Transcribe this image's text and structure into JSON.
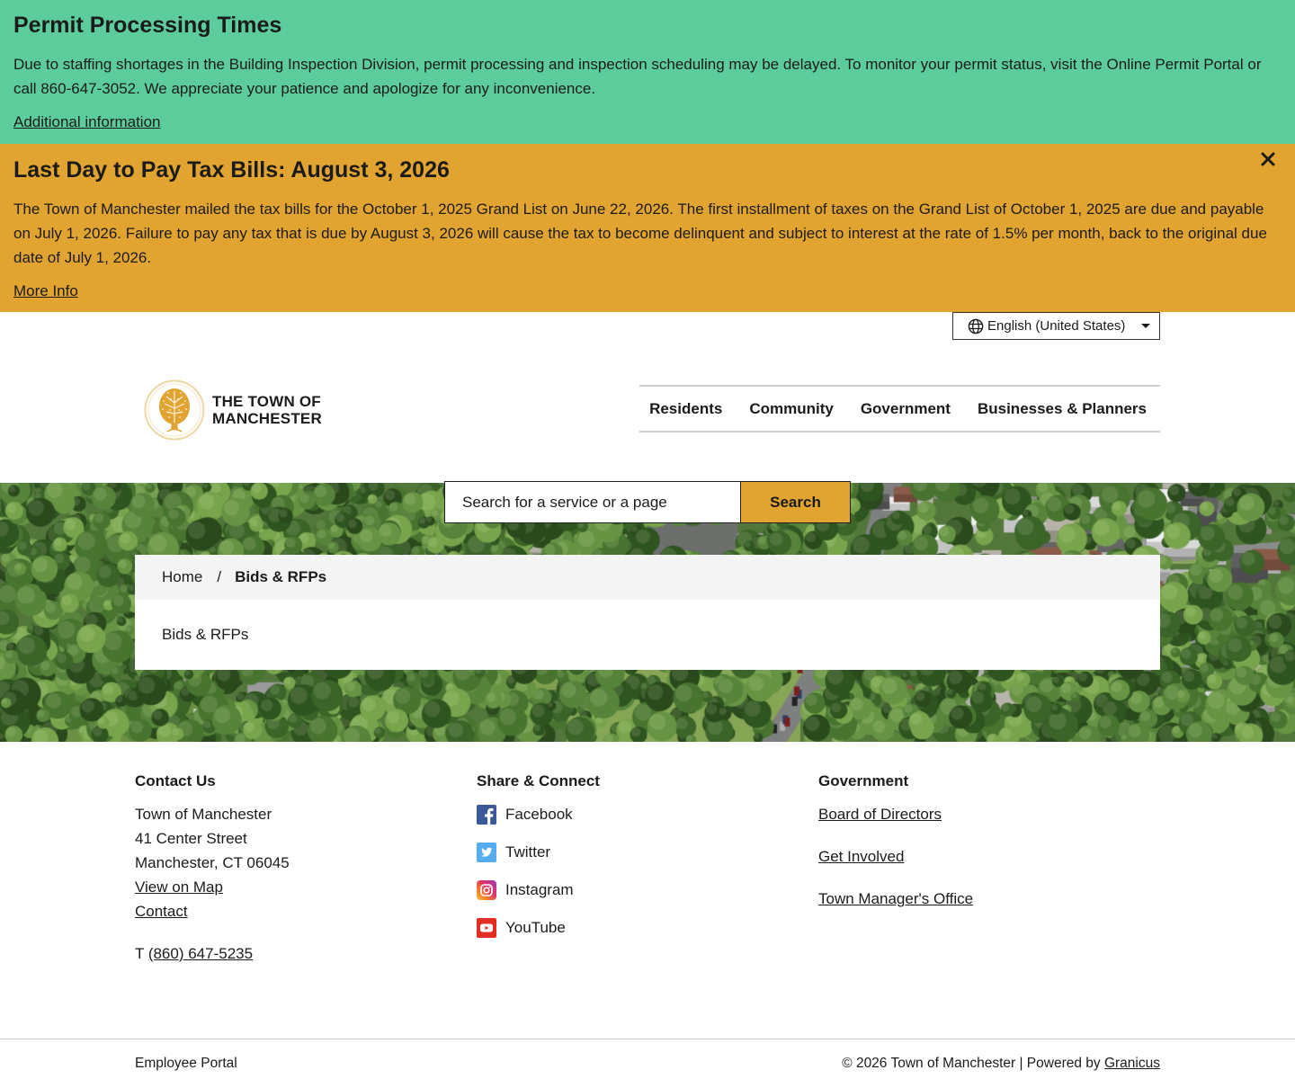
{
  "theme": {
    "alert_green": "#5CCC9C",
    "alert_orange": "#E2A431",
    "accent": "#E2A431"
  },
  "alerts": {
    "permit": {
      "title": "Permit Processing Times",
      "body": "Due to staffing shortages in the Building Inspection Division, permit processing and inspection scheduling may be delayed. To monitor your permit status, visit the Online Permit Portal or call 860-647-3052. We appreciate your patience and apologize for any inconvenience.",
      "link": "Additional information"
    },
    "tax": {
      "title": "Last Day to Pay Tax Bills: August 3, 2026",
      "body": "The Town of Manchester mailed the tax bills for the October 1, 2025 Grand List on June 22, 2026. The first installment of taxes on the Grand List of October 1, 2025 are due and payable on July 1, 2026. Failure to pay any tax that is due by August 3, 2026 will cause the tax to become delinquent and subject to interest at the rate of 1.5% per month, back to the original due date of July 1, 2026.",
      "link": "More Info",
      "close_icon": "close-icon"
    }
  },
  "language": {
    "selected": "English (United States)",
    "icon": "globe-icon"
  },
  "header": {
    "logo_icon": "town-seal-tree-icon",
    "logo_line1": "THE TOWN OF",
    "logo_line2": "MANCHESTER",
    "nav": [
      "Residents",
      "Community",
      "Government",
      "Businesses & Planners"
    ]
  },
  "search": {
    "placeholder": "Search for a service or a page",
    "button": "Search"
  },
  "breadcrumb": {
    "home": "Home",
    "separator": "/",
    "current": "Bids & RFPs"
  },
  "page": {
    "title": "Bids & RFPs"
  },
  "footer": {
    "contact": {
      "heading": "Contact Us",
      "lines": [
        "Town of Manchester",
        "41 Center Street",
        "Manchester, CT 06045"
      ],
      "links": [
        "View on Map",
        "Contact"
      ],
      "phone_prefix": "T",
      "phone": "(860) 647-5235"
    },
    "share": {
      "heading": "Share & Connect",
      "items": [
        {
          "label": "Facebook",
          "icon": "facebook-icon"
        },
        {
          "label": "Twitter",
          "icon": "twitter-icon"
        },
        {
          "label": "Instagram",
          "icon": "instagram-icon"
        },
        {
          "label": "YouTube",
          "icon": "youtube-icon"
        }
      ]
    },
    "government": {
      "heading": "Government",
      "links": [
        "Board of Directors",
        "Get Involved",
        "Town Manager's Office"
      ]
    }
  },
  "bottom": {
    "employee_portal": "Employee Portal",
    "copyright": "© 2026 Town of Manchester | Powered by",
    "powered_link": "Granicus"
  }
}
